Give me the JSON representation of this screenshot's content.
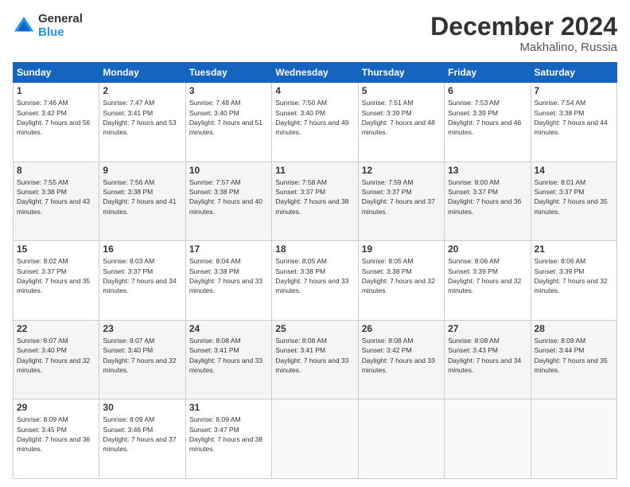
{
  "logo": {
    "general": "General",
    "blue": "Blue"
  },
  "title": "December 2024",
  "location": "Makhalino, Russia",
  "days_header": [
    "Sunday",
    "Monday",
    "Tuesday",
    "Wednesday",
    "Thursday",
    "Friday",
    "Saturday"
  ],
  "weeks": [
    [
      {
        "day": "1",
        "sunrise": "7:46 AM",
        "sunset": "3:42 PM",
        "daylight": "7 hours and 56 minutes."
      },
      {
        "day": "2",
        "sunrise": "7:47 AM",
        "sunset": "3:41 PM",
        "daylight": "7 hours and 53 minutes."
      },
      {
        "day": "3",
        "sunrise": "7:48 AM",
        "sunset": "3:40 PM",
        "daylight": "7 hours and 51 minutes."
      },
      {
        "day": "4",
        "sunrise": "7:50 AM",
        "sunset": "3:40 PM",
        "daylight": "7 hours and 49 minutes."
      },
      {
        "day": "5",
        "sunrise": "7:51 AM",
        "sunset": "3:39 PM",
        "daylight": "7 hours and 48 minutes."
      },
      {
        "day": "6",
        "sunrise": "7:53 AM",
        "sunset": "3:39 PM",
        "daylight": "7 hours and 46 minutes."
      },
      {
        "day": "7",
        "sunrise": "7:54 AM",
        "sunset": "3:38 PM",
        "daylight": "7 hours and 44 minutes."
      }
    ],
    [
      {
        "day": "8",
        "sunrise": "7:55 AM",
        "sunset": "3:38 PM",
        "daylight": "7 hours and 43 minutes."
      },
      {
        "day": "9",
        "sunrise": "7:56 AM",
        "sunset": "3:38 PM",
        "daylight": "7 hours and 41 minutes."
      },
      {
        "day": "10",
        "sunrise": "7:57 AM",
        "sunset": "3:38 PM",
        "daylight": "7 hours and 40 minutes."
      },
      {
        "day": "11",
        "sunrise": "7:58 AM",
        "sunset": "3:37 PM",
        "daylight": "7 hours and 38 minutes."
      },
      {
        "day": "12",
        "sunrise": "7:59 AM",
        "sunset": "3:37 PM",
        "daylight": "7 hours and 37 minutes."
      },
      {
        "day": "13",
        "sunrise": "8:00 AM",
        "sunset": "3:37 PM",
        "daylight": "7 hours and 36 minutes."
      },
      {
        "day": "14",
        "sunrise": "8:01 AM",
        "sunset": "3:37 PM",
        "daylight": "7 hours and 35 minutes."
      }
    ],
    [
      {
        "day": "15",
        "sunrise": "8:02 AM",
        "sunset": "3:37 PM",
        "daylight": "7 hours and 35 minutes."
      },
      {
        "day": "16",
        "sunrise": "8:03 AM",
        "sunset": "3:37 PM",
        "daylight": "7 hours and 34 minutes."
      },
      {
        "day": "17",
        "sunrise": "8:04 AM",
        "sunset": "3:38 PM",
        "daylight": "7 hours and 33 minutes."
      },
      {
        "day": "18",
        "sunrise": "8:05 AM",
        "sunset": "3:38 PM",
        "daylight": "7 hours and 33 minutes."
      },
      {
        "day": "19",
        "sunrise": "8:05 AM",
        "sunset": "3:38 PM",
        "daylight": "7 hours and 32 minutes."
      },
      {
        "day": "20",
        "sunrise": "8:06 AM",
        "sunset": "3:39 PM",
        "daylight": "7 hours and 32 minutes."
      },
      {
        "day": "21",
        "sunrise": "8:06 AM",
        "sunset": "3:39 PM",
        "daylight": "7 hours and 32 minutes."
      }
    ],
    [
      {
        "day": "22",
        "sunrise": "8:07 AM",
        "sunset": "3:40 PM",
        "daylight": "7 hours and 32 minutes."
      },
      {
        "day": "23",
        "sunrise": "8:07 AM",
        "sunset": "3:40 PM",
        "daylight": "7 hours and 32 minutes."
      },
      {
        "day": "24",
        "sunrise": "8:08 AM",
        "sunset": "3:41 PM",
        "daylight": "7 hours and 33 minutes."
      },
      {
        "day": "25",
        "sunrise": "8:08 AM",
        "sunset": "3:41 PM",
        "daylight": "7 hours and 33 minutes."
      },
      {
        "day": "26",
        "sunrise": "8:08 AM",
        "sunset": "3:42 PM",
        "daylight": "7 hours and 33 minutes."
      },
      {
        "day": "27",
        "sunrise": "8:08 AM",
        "sunset": "3:43 PM",
        "daylight": "7 hours and 34 minutes."
      },
      {
        "day": "28",
        "sunrise": "8:09 AM",
        "sunset": "3:44 PM",
        "daylight": "7 hours and 35 minutes."
      }
    ],
    [
      {
        "day": "29",
        "sunrise": "8:09 AM",
        "sunset": "3:45 PM",
        "daylight": "7 hours and 36 minutes."
      },
      {
        "day": "30",
        "sunrise": "8:09 AM",
        "sunset": "3:46 PM",
        "daylight": "7 hours and 37 minutes."
      },
      {
        "day": "31",
        "sunrise": "8:09 AM",
        "sunset": "3:47 PM",
        "daylight": "7 hours and 38 minutes."
      },
      null,
      null,
      null,
      null
    ]
  ]
}
